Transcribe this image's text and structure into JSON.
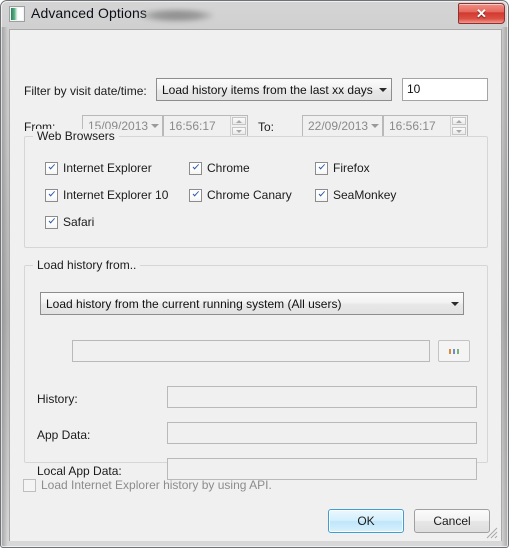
{
  "window": {
    "title": "Advanced Options",
    "icon": "app-window-icon",
    "redacted_label": "",
    "close_label": "✕"
  },
  "filter": {
    "label": "Filter by visit date/time:",
    "mode_value": "Load history items from the last xx days",
    "days_value": "10"
  },
  "range": {
    "from_label": "From:",
    "from_date": "15/09/2013",
    "from_time": "16:56:17",
    "to_label": "To:",
    "to_date": "22/09/2013",
    "to_time": "16:56:17"
  },
  "browsers": {
    "title": "Web Browsers",
    "items": [
      {
        "label": "Internet Explorer",
        "checked": true
      },
      {
        "label": "Chrome",
        "checked": true
      },
      {
        "label": "Firefox",
        "checked": true
      },
      {
        "label": "Internet Explorer 10",
        "checked": true
      },
      {
        "label": "Chrome Canary",
        "checked": true
      },
      {
        "label": "SeaMonkey",
        "checked": true
      },
      {
        "label": "Safari",
        "checked": true
      }
    ]
  },
  "source": {
    "title": "Load history from..",
    "mode_value": "Load history from the current running system (All users)",
    "path_value": "",
    "browse_label": "...",
    "fields": [
      {
        "label": "History:",
        "value": ""
      },
      {
        "label": "App Data:",
        "value": ""
      },
      {
        "label": "Local App Data:",
        "value": ""
      }
    ]
  },
  "api_option": {
    "label": "Load Internet Explorer history by using API.",
    "checked": false
  },
  "footer": {
    "ok_label": "OK",
    "cancel_label": "Cancel"
  },
  "colors": {
    "accent": "#3c9fd4",
    "close": "#d0392f",
    "check": "#2a5caa"
  }
}
